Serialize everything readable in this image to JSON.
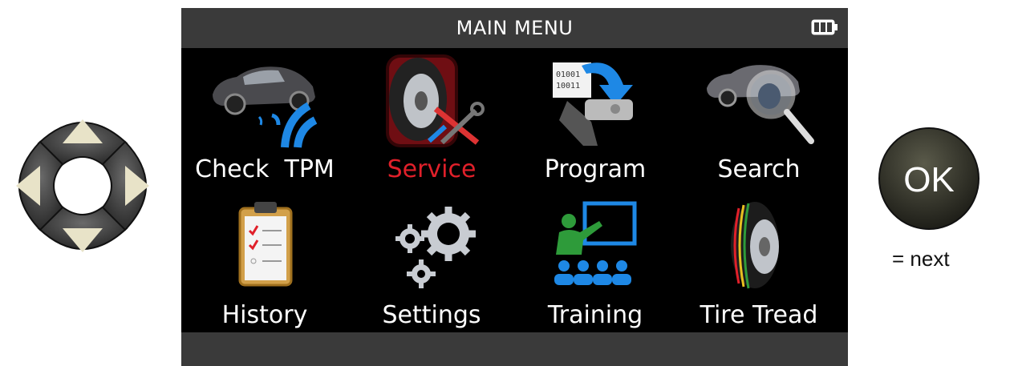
{
  "screen": {
    "title": "MAIN MENU",
    "battery_icon": "battery-full-icon",
    "menu": [
      {
        "label": "Check  TPM",
        "icon": "car-sensor-icon",
        "active": false
      },
      {
        "label": "Service",
        "icon": "tire-tools-icon",
        "active": true
      },
      {
        "label": "Program",
        "icon": "program-sensor-icon",
        "active": false
      },
      {
        "label": "Search",
        "icon": "car-search-icon",
        "active": false
      },
      {
        "label": "History",
        "icon": "clipboard-icon",
        "active": false
      },
      {
        "label": "Settings",
        "icon": "gears-icon",
        "active": false
      },
      {
        "label": "Training",
        "icon": "training-icon",
        "active": false
      },
      {
        "label": "Tire Tread",
        "icon": "tire-tread-icon",
        "active": false
      }
    ],
    "program_icon_text": [
      "01001",
      "10011"
    ],
    "colors": {
      "title_bar": "#3a3a3a",
      "background": "#000000",
      "active_label": "#e0202a",
      "label": "#ffffff"
    }
  },
  "controls": {
    "dpad_icon": "dpad-icon",
    "ok_label": "OK",
    "ok_caption": "= next"
  }
}
